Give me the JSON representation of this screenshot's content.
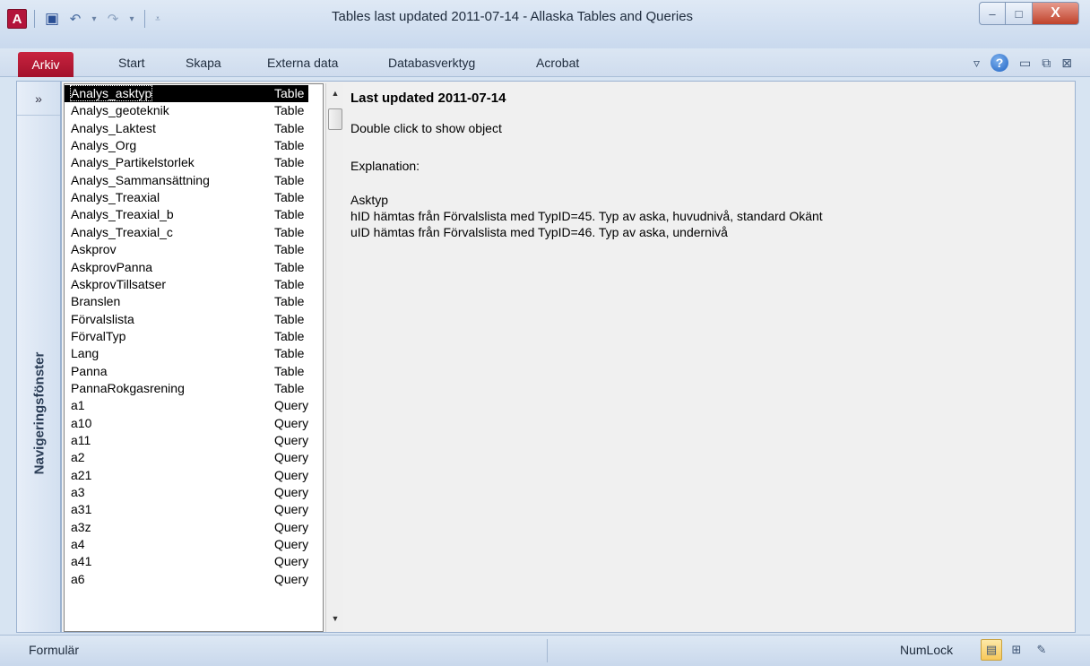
{
  "window": {
    "title": "Tables last updated 2011-07-14  -  Allaska Tables and Queries",
    "app_icon_letter": "A",
    "controls": {
      "minimize": "–",
      "maximize": "□",
      "close": "X"
    }
  },
  "quick_access": {
    "save_icon": "save-icon",
    "undo_icon": "undo-icon",
    "redo_icon": "redo-icon",
    "customize_icon": "customize-icon"
  },
  "ribbon": {
    "file_tab": "Arkiv",
    "tabs": [
      "Start",
      "Skapa",
      "Externa data",
      "Databasverktyg",
      "Acrobat"
    ]
  },
  "nav_pane": {
    "toggle": "»",
    "label": "Navigeringsfönster"
  },
  "list": {
    "selected_index": 0,
    "items": [
      {
        "name": "Analys_asktyp",
        "type": "Table"
      },
      {
        "name": "Analys_geoteknik",
        "type": "Table"
      },
      {
        "name": "Analys_Laktest",
        "type": "Table"
      },
      {
        "name": "Analys_Org",
        "type": "Table"
      },
      {
        "name": "Analys_Partikelstorlek",
        "type": "Table"
      },
      {
        "name": "Analys_Sammansättning",
        "type": "Table"
      },
      {
        "name": "Analys_Treaxial",
        "type": "Table"
      },
      {
        "name": "Analys_Treaxial_b",
        "type": "Table"
      },
      {
        "name": "Analys_Treaxial_c",
        "type": "Table"
      },
      {
        "name": "Askprov",
        "type": "Table"
      },
      {
        "name": "AskprovPanna",
        "type": "Table"
      },
      {
        "name": "AskprovTillsatser",
        "type": "Table"
      },
      {
        "name": "Branslen",
        "type": "Table"
      },
      {
        "name": "Förvalslista",
        "type": "Table"
      },
      {
        "name": "FörvalTyp",
        "type": "Table"
      },
      {
        "name": "Lang",
        "type": "Table"
      },
      {
        "name": "Panna",
        "type": "Table"
      },
      {
        "name": "PannaRokgasrening",
        "type": "Table"
      },
      {
        "name": "a1",
        "type": "Query"
      },
      {
        "name": "a10",
        "type": "Query"
      },
      {
        "name": "a11",
        "type": "Query"
      },
      {
        "name": "a2",
        "type": "Query"
      },
      {
        "name": "a21",
        "type": "Query"
      },
      {
        "name": "a3",
        "type": "Query"
      },
      {
        "name": "a31",
        "type": "Query"
      },
      {
        "name": "a3z",
        "type": "Query"
      },
      {
        "name": "a4",
        "type": "Query"
      },
      {
        "name": "a41",
        "type": "Query"
      },
      {
        "name": "a6",
        "type": "Query"
      }
    ]
  },
  "info": {
    "title": "Last updated 2011-07-14",
    "hint": "Double click to show object",
    "explanation_label": "Explanation:",
    "object_name": "Asktyp",
    "line1": "hID hämtas från Förvalslista  med TypID=45. Typ av aska, huvudnivå, standard Okänt",
    "line2": "uID hämtas från Förvalslista  med TypID=46. Typ av aska, undernivå"
  },
  "status": {
    "view_name": "Formulär",
    "numlock": "NumLock"
  }
}
